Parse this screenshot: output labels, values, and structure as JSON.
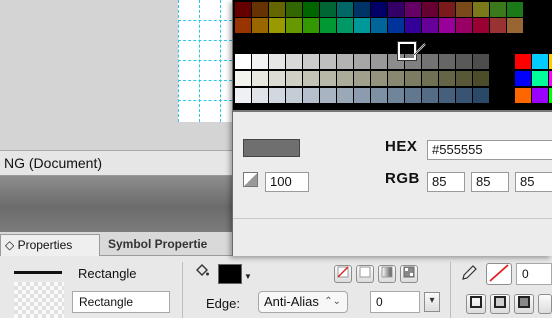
{
  "document_tab": {
    "label": "NG (Document)"
  },
  "panel_tabs": [
    {
      "label": "◇ Properties"
    },
    {
      "label": "Symbol Propertie"
    }
  ],
  "color_picker": {
    "hex_label": "HEX",
    "hex_value": "#555555",
    "rgb_label": "RGB",
    "r": "85",
    "g": "85",
    "b": "85",
    "alpha": "100",
    "current_color": "#555555"
  },
  "properties": {
    "stroke_type": "Rectangle",
    "object_name": "Rectangle",
    "edge_label": "Edge:",
    "edge_value": "Anti-Alias",
    "feather_value": "0",
    "stroke_size": "0",
    "fill_color": "#000000"
  },
  "icons": [
    "paint-bucket-icon",
    "pencil-icon",
    "no-stroke-icon",
    "chevron-down-icon"
  ]
}
